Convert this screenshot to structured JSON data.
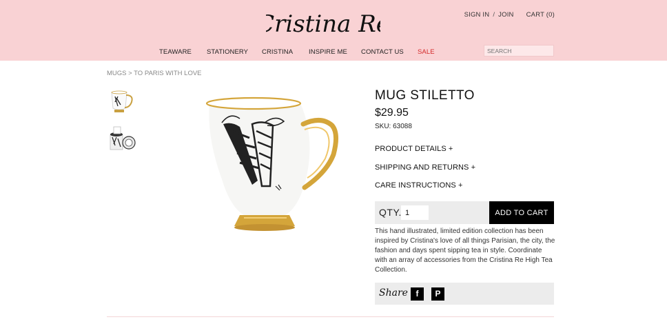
{
  "header": {
    "logo_text": "Cristina Re",
    "sign_in": "SIGN IN",
    "separator": "/",
    "join": "JOIN",
    "cart": "CART (0)",
    "search_placeholder": "SEARCH"
  },
  "nav": {
    "items": [
      "TEAWARE",
      "STATIONERY",
      "CRISTINA",
      "INSPIRE ME",
      "CONTACT US",
      "SALE"
    ]
  },
  "breadcrumb": {
    "text": "MUGS > TO PARIS WITH LOVE"
  },
  "product": {
    "title": "MUG STILETTO",
    "price": "$29.95",
    "sku": "SKU: 63088",
    "accordions": [
      "PRODUCT DETAILS +",
      "SHIPPING AND RETURNS +",
      "CARE INSTRUCTIONS +"
    ],
    "qty_label": "QTY.",
    "qty_value": "1",
    "add_to_cart": "ADD TO CART",
    "description": "This hand illustrated, limited edition collection has been inspired by Cristina's love of all things Parisian, the city, the fashion and days spent sipping tea in style. Coordinate with an array of accessories from the Cristina Re High Tea Collection.",
    "share_label": "Share"
  },
  "social": {
    "facebook": "f",
    "pinterest": "P"
  },
  "colors": {
    "header_bg": "#f9d2d4",
    "sale": "#d42a2a",
    "gold": "#d4a53a",
    "button_bg": "#000000"
  }
}
